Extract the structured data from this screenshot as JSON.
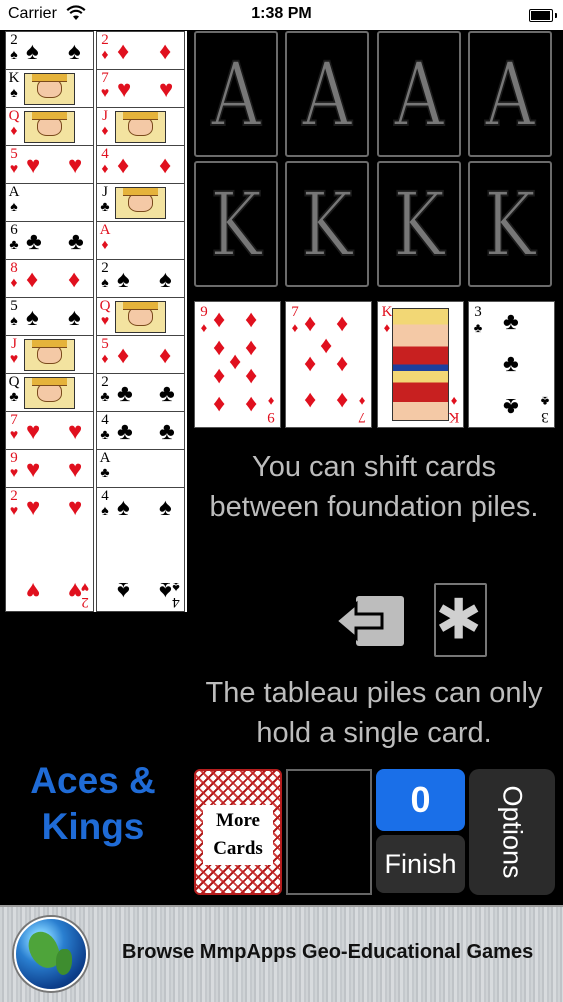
{
  "status_bar": {
    "carrier": "Carrier",
    "time": "1:38 PM",
    "battery_level": 1.0
  },
  "tableau": {
    "column_1": [
      {
        "rank": "2",
        "suit": "♠",
        "color": "black"
      },
      {
        "rank": "K",
        "suit": "♠",
        "color": "black",
        "face": true
      },
      {
        "rank": "Q",
        "suit": "♦",
        "color": "red",
        "face": true
      },
      {
        "rank": "5",
        "suit": "♥",
        "color": "red"
      },
      {
        "rank": "A",
        "suit": "♠",
        "color": "black"
      },
      {
        "rank": "6",
        "suit": "♣",
        "color": "black"
      },
      {
        "rank": "8",
        "suit": "♦",
        "color": "red"
      },
      {
        "rank": "5",
        "suit": "♠",
        "color": "black"
      },
      {
        "rank": "J",
        "suit": "♥",
        "color": "red",
        "face": true
      },
      {
        "rank": "Q",
        "suit": "♣",
        "color": "black",
        "face": true
      },
      {
        "rank": "7",
        "suit": "♥",
        "color": "red"
      },
      {
        "rank": "9",
        "suit": "♥",
        "color": "red"
      },
      {
        "rank": "2",
        "suit": "♥",
        "color": "red",
        "full": true
      }
    ],
    "column_2": [
      {
        "rank": "2",
        "suit": "♦",
        "color": "red"
      },
      {
        "rank": "7",
        "suit": "♥",
        "color": "red"
      },
      {
        "rank": "J",
        "suit": "♦",
        "color": "red",
        "face": true
      },
      {
        "rank": "4",
        "suit": "♦",
        "color": "red"
      },
      {
        "rank": "J",
        "suit": "♣",
        "color": "black",
        "face": true
      },
      {
        "rank": "A",
        "suit": "♦",
        "color": "red"
      },
      {
        "rank": "2",
        "suit": "♠",
        "color": "black"
      },
      {
        "rank": "Q",
        "suit": "♥",
        "color": "red",
        "face": true
      },
      {
        "rank": "5",
        "suit": "♦",
        "color": "red"
      },
      {
        "rank": "2",
        "suit": "♣",
        "color": "black"
      },
      {
        "rank": "4",
        "suit": "♣",
        "color": "black"
      },
      {
        "rank": "A",
        "suit": "♣",
        "color": "black"
      },
      {
        "rank": "4",
        "suit": "♠",
        "color": "black",
        "full": true
      }
    ]
  },
  "foundations": {
    "aces": [
      "A",
      "A",
      "A",
      "A"
    ],
    "kings": [
      "K",
      "K",
      "K",
      "K"
    ]
  },
  "reserve": [
    {
      "rank": "9",
      "suit": "♦",
      "color": "red"
    },
    {
      "rank": "7",
      "suit": "♦",
      "color": "red"
    },
    {
      "rank": "K",
      "suit": "♦",
      "color": "red",
      "face": true
    },
    {
      "rank": "3",
      "suit": "♣",
      "color": "black"
    }
  ],
  "message": {
    "line1": "You can shift cards between foundation piles.",
    "line2": "The tableau piles can only hold a single card."
  },
  "icons": {
    "shift": "shift-left-icon",
    "asterisk": "asterisk-icon"
  },
  "title": {
    "line1": "Aces &",
    "line2": "Kings"
  },
  "controls": {
    "stock_label_1": "More",
    "stock_label_2": "Cards",
    "score": "0",
    "finish_label": "Finish",
    "options_label": "Options"
  },
  "banner": {
    "text": "Browse MmpApps Geo-Educational Games",
    "icon": "globe-icon"
  },
  "colors": {
    "title_blue": "#1f6bd6",
    "score_blue": "#1a6fe8",
    "card_red": "#e0101e"
  }
}
